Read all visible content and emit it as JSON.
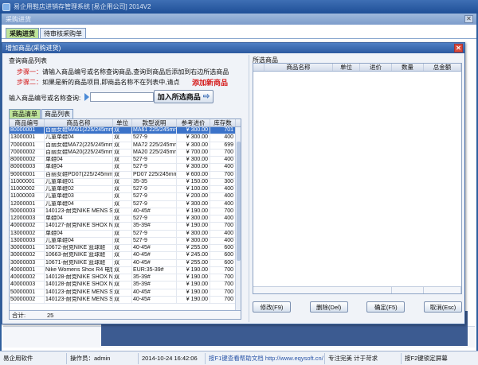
{
  "app": {
    "title": "易企用鞋店进销存管理系统 [易企用公司] 2014V2"
  },
  "bg_window": {
    "title": "采购进货",
    "tabs": [
      "采购进货",
      "待审核采购单"
    ]
  },
  "dialog": {
    "title": "增加商品(采购进货)",
    "query_title": "查询商品列表",
    "step1_label": "步骤一：",
    "step1_text": "请输入商品编号或名称查询商品,查询到商品后添加到右边所选商品",
    "step2_label": "步骤二：",
    "step2_text": "如果是新的商品项目,即商品名称不在列表中,请点",
    "add_new_label": "添加新商品",
    "search_label": "输入商品编号或名称查询:",
    "search_value": "",
    "add_selected_label": "加入所选商品",
    "tabs": [
      "商品清单",
      "商品列表"
    ],
    "product_columns": [
      "商品编号",
      "商品名称",
      "单位",
      "款型说明",
      "参考进价",
      "库存数"
    ],
    "products": [
      [
        "80000001",
        "百丽女鞋MA61(225/245mm",
        "双",
        "MA61 225/245mm",
        "¥ 300.00",
        "701"
      ],
      [
        "13000001",
        "儿童单鞋04",
        "双",
        "527-9",
        "¥ 300.00",
        "400"
      ],
      [
        "70000001",
        "百丽女鞋MA72(225/245mm",
        "双",
        "MA72 225/245mm",
        "¥ 300.00",
        "699"
      ],
      [
        "70000002",
        "百丽女鞋MA20(225/245mm",
        "双",
        "MA20 225/245mm",
        "¥ 700.00",
        "700"
      ],
      [
        "80000002",
        "单鞋04",
        "双",
        "527-9",
        "¥ 300.00",
        "400"
      ],
      [
        "80000003",
        "单鞋04",
        "双",
        "527-9",
        "¥ 300.00",
        "400"
      ],
      [
        "90000001",
        "百丽女鞋PD07(225/245mm)",
        "双",
        "PD07 225/245mm",
        "¥ 600.00",
        "700"
      ],
      [
        "11000001",
        "儿童单鞋01",
        "双",
        "35-35",
        "¥ 150.00",
        "300"
      ],
      [
        "11000002",
        "儿童单鞋02",
        "双",
        "527-9",
        "¥ 100.00",
        "400"
      ],
      [
        "11000003",
        "儿童单鞋03",
        "双",
        "527-9",
        "¥ 200.00",
        "400"
      ],
      [
        "12000001",
        "儿童单鞋04",
        "双",
        "527-9",
        "¥ 300.00",
        "400"
      ],
      [
        "50000003",
        "140123-耐克NIKE MENS SHO",
        "双",
        "40-45#",
        "¥ 190.00",
        "700"
      ],
      [
        "12000003",
        "单鞋04",
        "双",
        "527-9",
        "¥ 300.00",
        "400"
      ],
      [
        "40000002",
        "140127-耐克NIKE SHOX NZ",
        "双",
        "35-39#",
        "¥ 190.00",
        "700"
      ],
      [
        "13000002",
        "单鞋04",
        "双",
        "527-9",
        "¥ 300.00",
        "400"
      ],
      [
        "13000003",
        "儿童单鞋04",
        "双",
        "527-9",
        "¥ 300.00",
        "400"
      ],
      [
        "30000001",
        "10672-耐克NIKE 篮球鞋",
        "双",
        "40-45#",
        "¥ 255.00",
        "600"
      ],
      [
        "30000002",
        "10663-耐克NIKE 篮球鞋",
        "双",
        "40-45#",
        "¥ 245.00",
        "600"
      ],
      [
        "30000003",
        "10671-耐克NIKE 篮球鞋",
        "双",
        "40-45#",
        "¥ 255.00",
        "600"
      ],
      [
        "40000001",
        "Nike Womens Shox R4 电镀",
        "双",
        "EUR:35-39#",
        "¥ 190.00",
        "700"
      ],
      [
        "40000002",
        "140128-耐克NIKE SHOX NZ",
        "双",
        "35-39#",
        "¥ 190.00",
        "700"
      ],
      [
        "40000003",
        "140128-耐克NIKE SHOX NZ",
        "双",
        "35-39#",
        "¥ 190.00",
        "700"
      ],
      [
        "50000001",
        "140123-耐克NIKE MENS SHO",
        "双",
        "40-45#",
        "¥ 190.00",
        "700"
      ],
      [
        "50000002",
        "140123-耐克NIKE MENS SHO",
        "双",
        "40-45#",
        "¥ 190.00",
        "700"
      ]
    ],
    "total_label": "合计:",
    "total_count": "25",
    "selected_title": "所选商品",
    "selected_columns": [
      "商品名称",
      "单位",
      "进价",
      "数量",
      "总金额"
    ],
    "buttons": {
      "edit": "修改(F9)",
      "delete": "删除(Del)",
      "confirm": "确定(F5)",
      "cancel": "取消(Esc)"
    }
  },
  "statusbar": {
    "software": "易企用软件",
    "operator": "操作员：admin",
    "datetime": "2014-10-24 16:42:06",
    "help": "按F1键查看帮助文档 http://www.eqysoft.cn/",
    "slogan": "专注完美  计于苛求",
    "lock": "按F2键锁定屏幕"
  }
}
